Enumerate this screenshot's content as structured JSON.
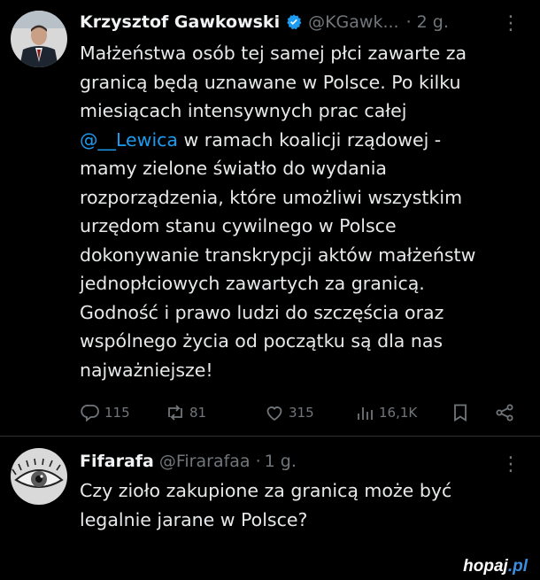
{
  "tweet1": {
    "author_name": "Krzysztof Gawkowski",
    "handle": "@KGawk...",
    "separator": "·",
    "time": "2 g.",
    "more": "⋮",
    "text_lines_before_mention": [
      "Małżeństwa osób tej samej płci zawarte za",
      "granicą będą uznawane w Polsce. Po kilku",
      "miesiącach intensywnych prac całej"
    ],
    "mention": "@__Lewica",
    "mention_suffix": " w ramach koalicji rządowej -",
    "text_lines_after_mention": [
      "mamy zielone światło do wydania",
      "rozporządzenia, które umożliwi wszystkim",
      "urzędom stanu cywilnego w Polsce",
      "dokonywanie transkrypcji aktów małżeństw",
      "jednopłciowych zawartych za granicą.",
      "Godność i prawo ludzi do szczęścia oraz",
      "wspólnego życia od początku są dla nas",
      "najważniejsze!"
    ],
    "stats": {
      "replies": "115",
      "retweets": "81",
      "likes": "315",
      "views": "16,1K"
    }
  },
  "tweet2": {
    "author_name": "Fifarafa",
    "handle": "@Firarafaa",
    "separator": "·",
    "time": "1 g.",
    "more": "⋮",
    "text_lines": [
      "Czy zioło zakupione za granicą może być",
      "legalnie jarane w Polsce?"
    ]
  },
  "watermark": {
    "main": "hopaj",
    "dot": ".",
    "tld": "pl"
  },
  "colors": {
    "background": "#000000",
    "text": "#e7e9ea",
    "muted": "#71767b",
    "accent": "#1d9bf0",
    "divider": "#2f3336"
  }
}
